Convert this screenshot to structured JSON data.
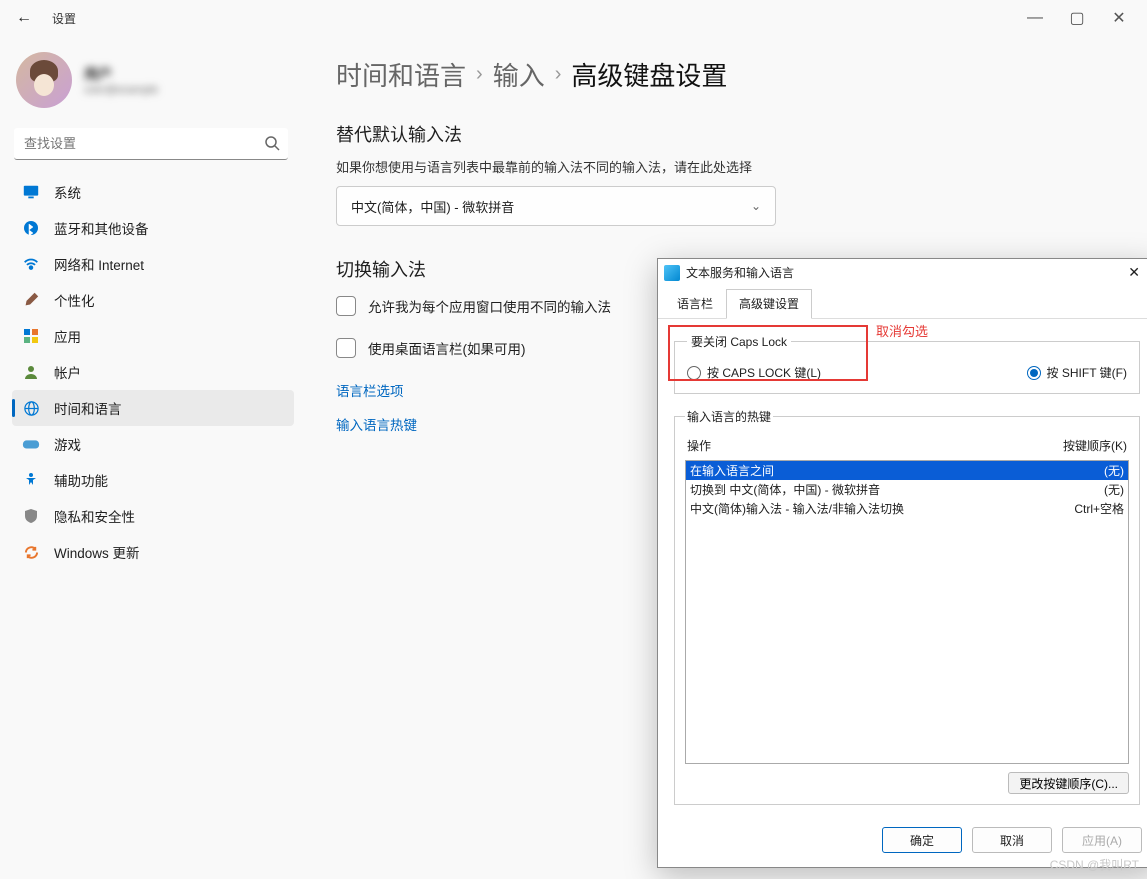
{
  "titlebar": {
    "title": "设置"
  },
  "user": {
    "name": "用户",
    "email": "user@example"
  },
  "search": {
    "placeholder": "查找设置"
  },
  "sidebar": {
    "items": [
      {
        "label": "系统",
        "icon": "💻"
      },
      {
        "label": "蓝牙和其他设备",
        "icon": "blue-dot"
      },
      {
        "label": "网络和 Internet",
        "icon": "wifi"
      },
      {
        "label": "个性化",
        "icon": "brush"
      },
      {
        "label": "应用",
        "icon": "apps"
      },
      {
        "label": "帐户",
        "icon": "person"
      },
      {
        "label": "时间和语言",
        "icon": "globe"
      },
      {
        "label": "游戏",
        "icon": "gamepad"
      },
      {
        "label": "辅助功能",
        "icon": "accessibility"
      },
      {
        "label": "隐私和安全性",
        "icon": "shield"
      },
      {
        "label": "Windows 更新",
        "icon": "update"
      }
    ]
  },
  "breadcrumb": {
    "a": "时间和语言",
    "b": "输入",
    "c": "高级键盘设置",
    "sep": "›"
  },
  "sec1": {
    "title": "替代默认输入法",
    "hint": "如果你想使用与语言列表中最靠前的输入法不同的输入法，请在此处选择",
    "select": "中文(简体，中国) - 微软拼音"
  },
  "sec2": {
    "title": "切换输入法",
    "c1": "允许我为每个应用窗口使用不同的输入法",
    "c2": "使用桌面语言栏(如果可用)",
    "link1": "语言栏选项",
    "link2": "输入语言热键"
  },
  "dialog": {
    "title": "文本服务和输入语言",
    "tabs": {
      "a": "语言栏",
      "b": "高级键设置"
    },
    "annotation": "取消勾选",
    "capslock": {
      "legend": "要关闭 Caps Lock",
      "r1": "按 CAPS LOCK 键(L)",
      "r2": "按 SHIFT 键(F)"
    },
    "hotkeys": {
      "legend": "输入语言的热键",
      "col1": "操作",
      "col2": "按键顺序(K)",
      "rows": [
        {
          "action": "在输入语言之间",
          "key": "(无)"
        },
        {
          "action": "切换到 中文(简体，中国) - 微软拼音",
          "key": "(无)"
        },
        {
          "action": "中文(简体)输入法 - 输入法/非输入法切换",
          "key": "Ctrl+空格"
        }
      ],
      "change_btn": "更改按键顺序(C)..."
    },
    "buttons": {
      "ok": "确定",
      "cancel": "取消",
      "apply": "应用(A)"
    }
  },
  "watermark": "CSDN @我叫RT"
}
